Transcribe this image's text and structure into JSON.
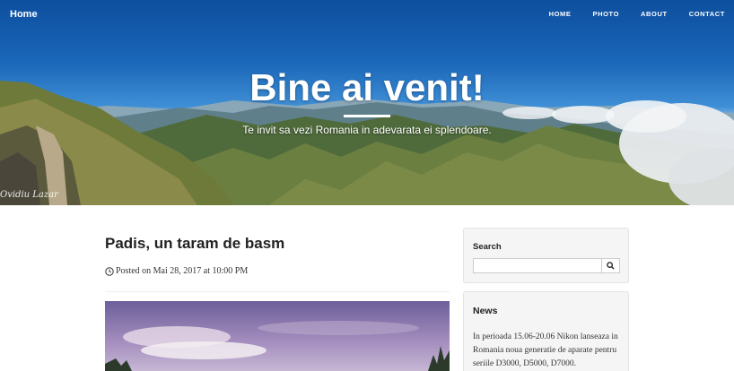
{
  "nav": {
    "home": "Home",
    "items": [
      {
        "label": "HOME"
      },
      {
        "label": "PHOTO"
      },
      {
        "label": "ABOUT"
      },
      {
        "label": "CONTACT"
      }
    ]
  },
  "hero": {
    "title": "Bine ai venit!",
    "subtitle": "Te invit sa vezi Romania in adevarata ei splendoare.",
    "signature": "Ovidiu Lazar"
  },
  "post": {
    "title": "Padis, un taram de basm",
    "meta": "Posted on Mai 28, 2017 at 10:00 PM"
  },
  "sidebar": {
    "search": {
      "title": "Search",
      "value": "",
      "button_icon": "search-icon"
    },
    "news": {
      "title": "News",
      "text": "In perioada 15.06-20.06 Nikon lanseaza in Romania noua generatie de aparate pentru seriile D3000, D5000, D7000."
    }
  },
  "colors": {
    "sky_top": "#0d4f9e",
    "widget_bg": "#f5f5f5",
    "heading": "#222222"
  }
}
